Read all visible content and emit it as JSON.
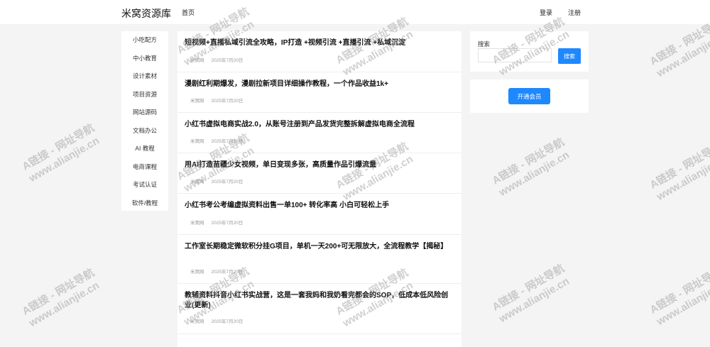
{
  "header": {
    "site_title": "米窝资源库",
    "nav_home": "首页",
    "login": "登录",
    "register": "注册"
  },
  "sidebar": {
    "items": [
      {
        "label": "小吃配方"
      },
      {
        "label": "中小教育"
      },
      {
        "label": "设计素材"
      },
      {
        "label": "项目资源"
      },
      {
        "label": "网站源码"
      },
      {
        "label": "文档办公"
      },
      {
        "label": "AI 教程"
      },
      {
        "label": "电商课程"
      },
      {
        "label": "考试认证"
      },
      {
        "label": "软件/教程"
      }
    ]
  },
  "posts": [
    {
      "title": "短视频+直播私域引流全攻略，IP打造 +视频引流 +直播引流 +私域沉淀",
      "source": "米窝网",
      "date": "2025年7月20日"
    },
    {
      "title": "漫剧红利期爆发，漫剧拉新项目详细操作教程，一个作品收益1k+",
      "source": "米窝网",
      "date": "2025年7月20日"
    },
    {
      "title": "小红书虚拟电商实战2.0，从账号注册到产品发货完整拆解虚拟电商全流程",
      "source": "米窝网",
      "date": "2025年7月20日"
    },
    {
      "title": "用AI打造苗疆少女视频，单日变现多张，高质量作品引爆流量",
      "source": "米窝网",
      "date": "2025年7月20日"
    },
    {
      "title": "小红书考公考编虚拟资料出售一单100+  转化率高  小白可轻松上手",
      "source": "米窝网",
      "date": "2025年7月20日"
    },
    {
      "title": "工作室长期稳定微软积分挂G项目，单机一天200+可无限放大，全流程教学【揭秘】",
      "source": "米窝网",
      "date": "2025年7月20日"
    },
    {
      "title": "教辅资料抖音小红书实战营，这是一套我妈和我奶看完都会的SOP，低成本低风险创业(更新)",
      "source": "米窝网",
      "date": "2025年7月20日"
    },
    {
      "title": "",
      "source": "",
      "date": ""
    }
  ],
  "search": {
    "label": "搜索",
    "placeholder": "",
    "value": "",
    "button_label": "搜索"
  },
  "vip": {
    "button_label": "开通会员"
  },
  "watermark": {
    "line1": "A链接 - 网址导航",
    "line2": "www.alianjie.cn"
  },
  "colors": {
    "accent": "#1e88ff",
    "page_bg": "#f4f4f4"
  }
}
